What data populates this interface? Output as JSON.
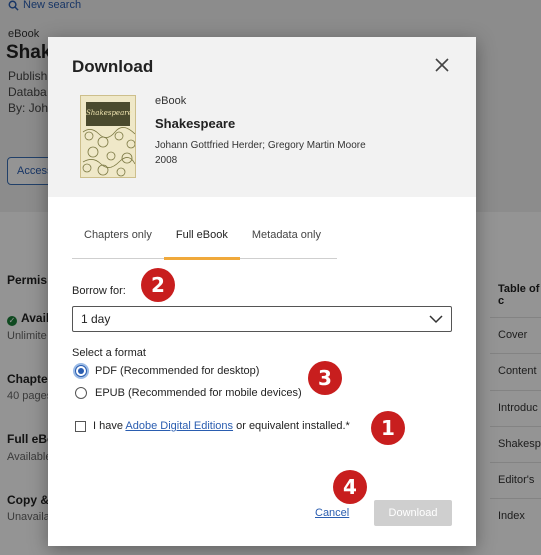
{
  "background": {
    "search_link": "New search",
    "item_type": "eBook",
    "title": "Shak",
    "meta_lines": [
      "Publish",
      "Databa",
      "By: Joha"
    ],
    "access_button": "Access",
    "permissions_heading": "Permis",
    "left_items": [
      {
        "label": "Avail",
        "sub": "Unlimite"
      },
      {
        "label": "Chapter",
        "sub": "40 pages"
      },
      {
        "label": "Full eBo",
        "sub": "Available"
      },
      {
        "label": "Copy & p",
        "sub": "Unavaila"
      }
    ],
    "toc_title": "Table of c",
    "toc_items": [
      "Cover",
      "Content",
      "Introduc",
      "Shakesp",
      "Editor's",
      "Index"
    ]
  },
  "modal": {
    "title": "Download",
    "book": {
      "type": "eBook",
      "title": "Shakespeare",
      "authors": "Johann Gottfried Herder; Gregory Martin Moore",
      "year": "2008",
      "cover_text": "Shakespeare"
    },
    "tabs": [
      {
        "label": "Chapters only",
        "active": false
      },
      {
        "label": "Full eBook",
        "active": true
      },
      {
        "label": "Metadata only",
        "active": false
      }
    ],
    "borrow": {
      "label": "Borrow for:",
      "value": "1 day"
    },
    "format": {
      "label": "Select a format",
      "options": [
        {
          "label": "PDF (Recommended for desktop)",
          "checked": true
        },
        {
          "label": "EPUB (Recommended for mobile devices)",
          "checked": false
        }
      ]
    },
    "agreement": {
      "prefix": "I have ",
      "link": "Adobe Digital Editions",
      "suffix": " or equivalent installed.*",
      "checked": false
    },
    "cancel_label": "Cancel",
    "download_label": "Download"
  },
  "markers": [
    "2",
    "3",
    "1",
    "4"
  ],
  "colors": {
    "accent_link": "#2a5db0",
    "tab_underline": "#f0a93b",
    "marker_red": "#c81e1e",
    "disabled_button": "#cfcfcf",
    "available_green": "#1a7f37"
  }
}
